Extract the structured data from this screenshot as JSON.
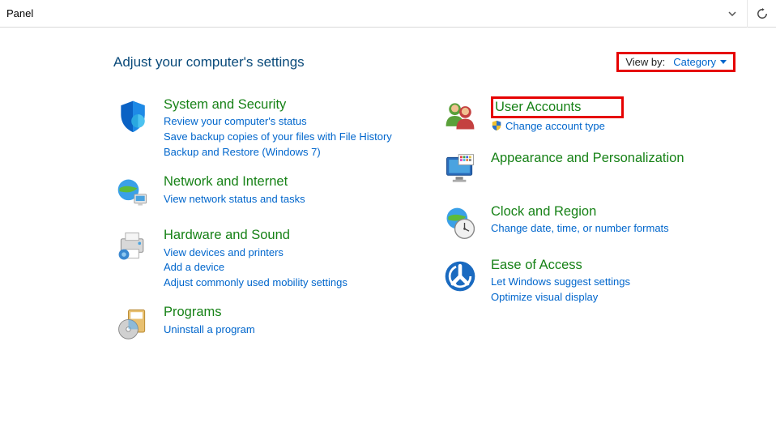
{
  "window": {
    "title": "Panel"
  },
  "header": {
    "heading": "Adjust your computer's settings",
    "view_by_label": "View by:",
    "view_by_value": "Category"
  },
  "left_column": [
    {
      "id": "system-security",
      "title": "System and Security",
      "links": [
        "Review your computer's status",
        "Save backup copies of your files with File History",
        "Backup and Restore (Windows 7)"
      ]
    },
    {
      "id": "network-internet",
      "title": "Network and Internet",
      "links": [
        "View network status and tasks"
      ]
    },
    {
      "id": "hardware-sound",
      "title": "Hardware and Sound",
      "links": [
        "View devices and printers",
        "Add a device",
        "Adjust commonly used mobility settings"
      ]
    },
    {
      "id": "programs",
      "title": "Programs",
      "links": [
        "Uninstall a program"
      ]
    }
  ],
  "right_column": [
    {
      "id": "user-accounts",
      "title": "User Accounts",
      "links": [
        "Change account type"
      ],
      "shield_on_links": [
        0
      ],
      "highlight": true
    },
    {
      "id": "appearance-personalization",
      "title": "Appearance and Personalization",
      "links": []
    },
    {
      "id": "clock-region",
      "title": "Clock and Region",
      "links": [
        "Change date, time, or number formats"
      ]
    },
    {
      "id": "ease-of-access",
      "title": "Ease of Access",
      "links": [
        "Let Windows suggest settings",
        "Optimize visual display"
      ]
    }
  ]
}
